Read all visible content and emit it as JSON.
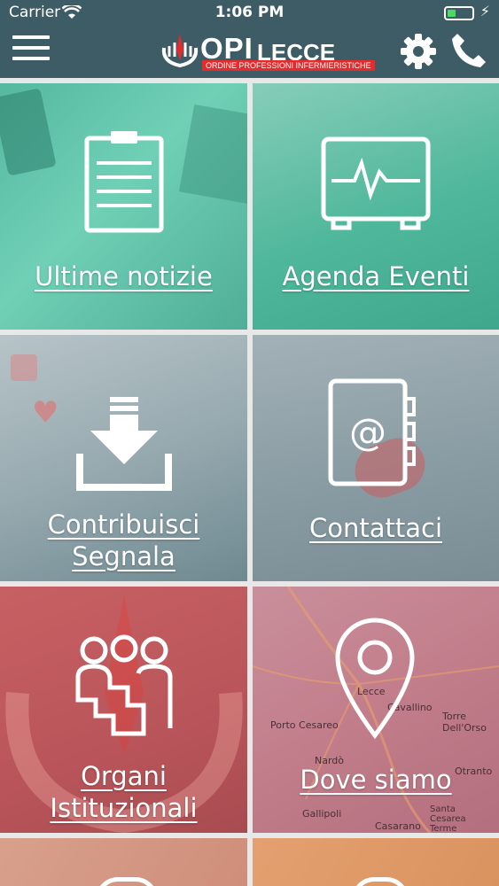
{
  "status": {
    "carrier": "Carrier",
    "time": "1:06 PM",
    "battery_fraction": 0.35
  },
  "header": {
    "logo": {
      "opi": "OPI",
      "lecce": "LECCE",
      "subtitle": "ORDINE PROFESSIONI INFERMIERISTICHE"
    },
    "left_icon": "hamburger-menu-icon",
    "right_icons": [
      "gear-icon",
      "phone-icon"
    ]
  },
  "tiles": [
    {
      "label": "Ultime notizie",
      "icon": "clipboard-icon",
      "color": "#5fc6ad"
    },
    {
      "label": "Agenda Eventi",
      "icon": "monitor-pulse-icon",
      "color": "#4bb89c"
    },
    {
      "label_line1": "Contribuisci",
      "label_line2": "Segnala",
      "icon": "download-tray-icon",
      "color": "#8a9ea6"
    },
    {
      "label": "Contattaci",
      "icon": "address-book-icon",
      "color": "#8b9ba2"
    },
    {
      "label_line1": "Organi",
      "label_line2": "Istituzionali",
      "icon": "group-people-icon",
      "color": "#c25a5d"
    },
    {
      "label": "Dove siamo",
      "icon": "map-pin-icon",
      "color": "#c47e8c"
    }
  ],
  "map_labels": [
    "Lecce",
    "Cavallino",
    "Porto Cesareo",
    "Nardò",
    "Torre Dell'Orso",
    "Gallipoli",
    "Santa Cesarea Terme",
    "Casarano",
    "Otranto"
  ]
}
